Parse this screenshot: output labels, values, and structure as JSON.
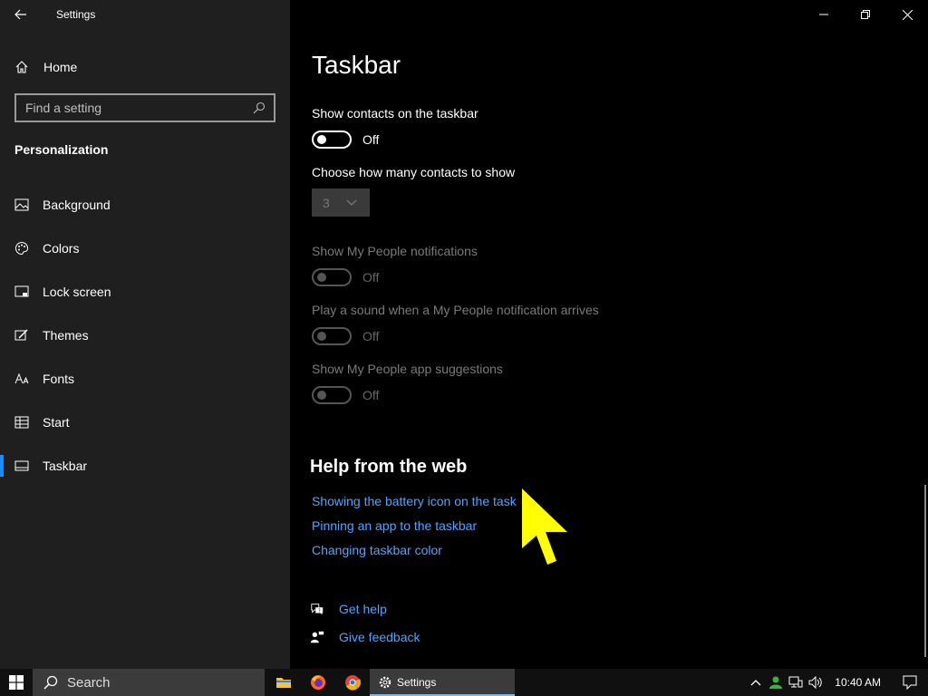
{
  "window": {
    "app_title": "Settings"
  },
  "sidebar": {
    "home_label": "Home",
    "search_placeholder": "Find a setting",
    "section_title": "Personalization",
    "items": [
      {
        "label": "Background",
        "icon": "picture-icon"
      },
      {
        "label": "Colors",
        "icon": "palette-icon"
      },
      {
        "label": "Lock screen",
        "icon": "lock-screen-icon"
      },
      {
        "label": "Themes",
        "icon": "brush-icon"
      },
      {
        "label": "Fonts",
        "icon": "font-icon"
      },
      {
        "label": "Start",
        "icon": "start-icon"
      },
      {
        "label": "Taskbar",
        "icon": "taskbar-icon",
        "selected": true
      }
    ]
  },
  "main": {
    "page_title": "Taskbar",
    "settings": [
      {
        "label": "Show contacts on the taskbar",
        "state": "Off",
        "enabled": true
      },
      {
        "label": "Choose how many contacts to show",
        "dropdown_value": "3",
        "enabled": false
      },
      {
        "label": "Show My People notifications",
        "state": "Off",
        "enabled": false
      },
      {
        "label": "Play a sound when a My People notification arrives",
        "state": "Off",
        "enabled": false
      },
      {
        "label": "Show My People app suggestions",
        "state": "Off",
        "enabled": false
      }
    ],
    "help_title": "Help from the web",
    "help_links": [
      "Showing the battery icon on the task",
      "Pinning an app to the taskbar",
      "Changing taskbar color"
    ],
    "footer": {
      "get_help": "Get help",
      "give_feedback": "Give feedback"
    }
  },
  "taskbar": {
    "search_label": "Search",
    "active_app": "Settings",
    "clock": "10:40 AM"
  },
  "colors": {
    "accent": "#1a8cff",
    "link": "#4ea3ff",
    "cursor": "#ffff00"
  }
}
